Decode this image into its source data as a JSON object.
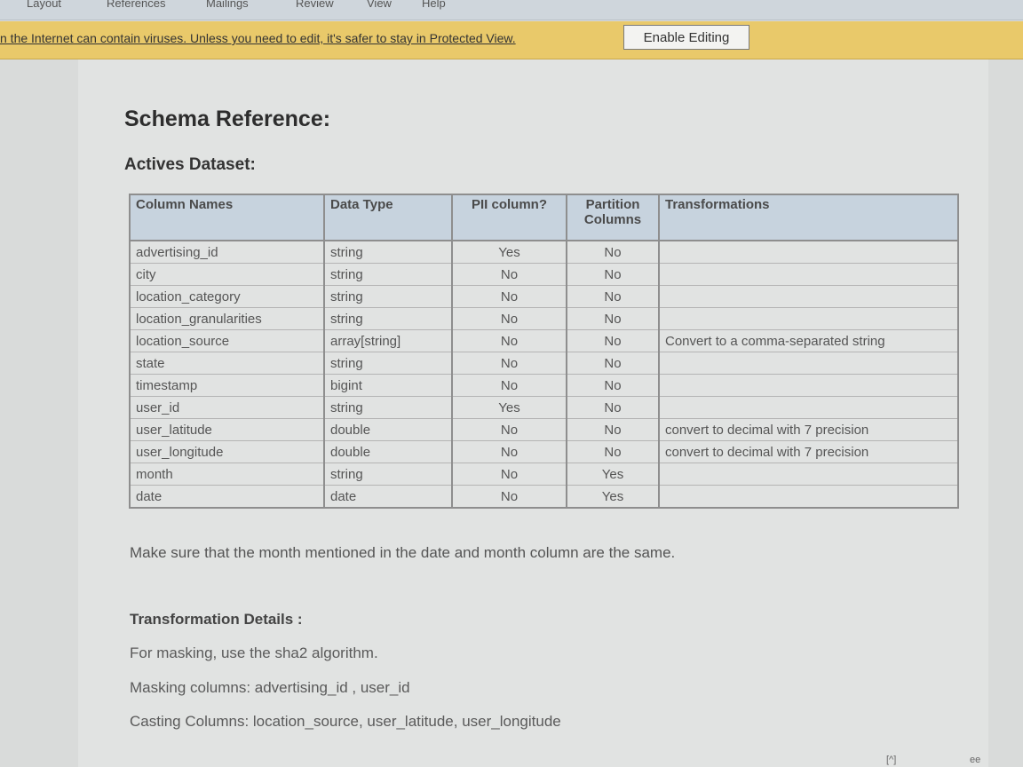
{
  "ribbon": {
    "tabs": [
      "Layout",
      "References",
      "Mailings",
      "Review",
      "View",
      "Help"
    ]
  },
  "protected_view": {
    "message": "n the Internet can contain viruses. Unless you need to edit, it's safer to stay in Protected View.",
    "button_label": "Enable Editing"
  },
  "document": {
    "title": "Schema Reference:",
    "subtitle": "Actives Dataset:",
    "table": {
      "headers": [
        "Column Names",
        "Data Type",
        "PII column?",
        "Partition Columns",
        "Transformations"
      ],
      "rows": [
        {
          "name": "advertising_id",
          "type": "string",
          "pii": "Yes",
          "partition": "No",
          "transformation": ""
        },
        {
          "name": "city",
          "type": "string",
          "pii": "No",
          "partition": "No",
          "transformation": ""
        },
        {
          "name": "location_category",
          "type": "string",
          "pii": "No",
          "partition": "No",
          "transformation": ""
        },
        {
          "name": "location_granularities",
          "type": "string",
          "pii": "No",
          "partition": "No",
          "transformation": ""
        },
        {
          "name": "location_source",
          "type": "array[string]",
          "pii": "No",
          "partition": "No",
          "transformation": "Convert to a comma-separated string"
        },
        {
          "name": "state",
          "type": "string",
          "pii": "No",
          "partition": "No",
          "transformation": ""
        },
        {
          "name": "timestamp",
          "type": "bigint",
          "pii": "No",
          "partition": "No",
          "transformation": ""
        },
        {
          "name": "user_id",
          "type": "string",
          "pii": "Yes",
          "partition": "No",
          "transformation": ""
        },
        {
          "name": "user_latitude",
          "type": "double",
          "pii": "No",
          "partition": "No",
          "transformation": "convert to decimal with 7 precision"
        },
        {
          "name": "user_longitude",
          "type": "double",
          "pii": "No",
          "partition": "No",
          "transformation": "convert to decimal with 7 precision"
        },
        {
          "name": "month",
          "type": "string",
          "pii": "No",
          "partition": "Yes",
          "transformation": ""
        },
        {
          "name": "date",
          "type": "date",
          "pii": "No",
          "partition": "Yes",
          "transformation": ""
        }
      ]
    },
    "note": "Make sure that the month mentioned in the date and month column are the same.",
    "transformation_details": {
      "heading": "Transformation Details :",
      "masking": "For masking, use the sha2 algorithm.",
      "masking_columns": "Masking columns: advertising_id , user_id",
      "casting_columns": "Casting Columns: location_source, user_latitude, user_longitude"
    }
  },
  "corner_marks": [
    "[^]",
    "ee"
  ]
}
